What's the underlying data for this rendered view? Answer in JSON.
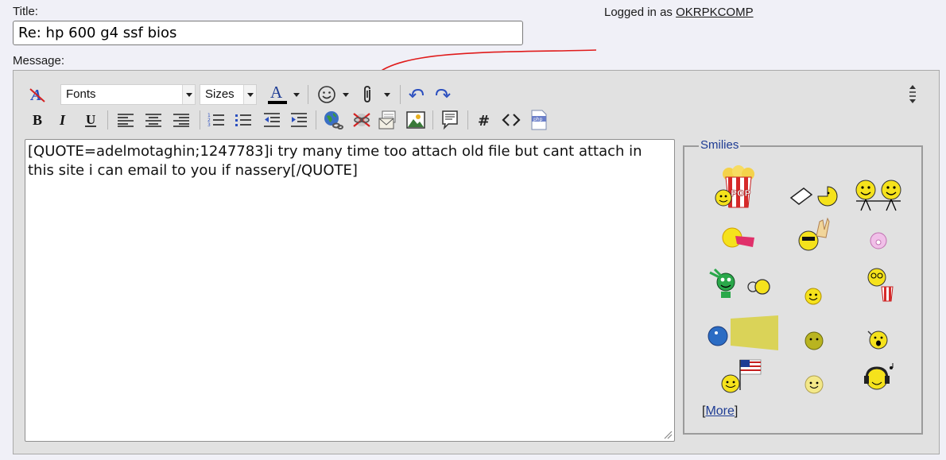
{
  "form": {
    "title_label": "Title:",
    "title_value": "Re: hp 600 g4 ssf bios",
    "message_label": "Message:",
    "logged_in_prefix": "Logged in as ",
    "username": "OKRPKCOMP"
  },
  "toolbar": {
    "fonts_label": "Fonts",
    "sizes_label": "Sizes"
  },
  "message": {
    "text": "[QUOTE=adelmotaghin;1247783]i try many time too attach old file but cant attach in this site i can email to you if nassery[/QUOTE]"
  },
  "smilies": {
    "legend": "Smilies",
    "more_bracket_open": "[",
    "more_label": "More",
    "more_bracket_close": "]",
    "pop_text": "POP"
  },
  "colors": {
    "page_bg": "#f0f0f7",
    "editor_bg": "#e1e1e1",
    "link_blue": "#1e3c94",
    "annotation_red": "#e01b1b",
    "smiley_yellow": "#f5e21c"
  }
}
